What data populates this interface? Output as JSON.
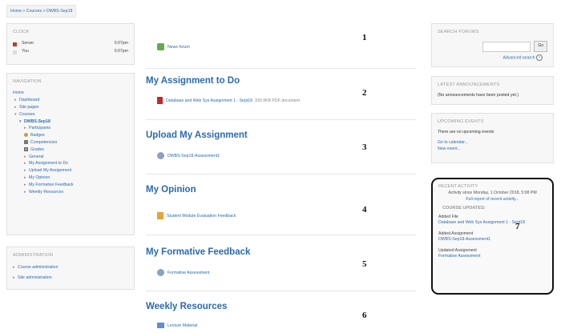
{
  "breadcrumb": {
    "home": "Home",
    "sep1": ">",
    "courses": "Courses",
    "sep2": ">",
    "course": "DWBS-Sep18"
  },
  "clock": {
    "title": "CLOCK",
    "rows": [
      {
        "name": "Server",
        "time": "5:07pm"
      },
      {
        "name": "You",
        "time": "5:07pm"
      }
    ]
  },
  "navigation": {
    "title": "NAVIGATION",
    "items": [
      {
        "label": "Home",
        "caret": ""
      },
      {
        "label": "Dashboard",
        "caret": "▸"
      },
      {
        "label": "Site pages",
        "caret": "▸"
      },
      {
        "label": "Courses",
        "caret": "▾"
      },
      {
        "label": "DWBS-Sep18",
        "caret": "▾"
      },
      {
        "label": "Participants",
        "caret": "▸"
      },
      {
        "label": "Badges",
        "caret": ""
      },
      {
        "label": "Competencies",
        "caret": ""
      },
      {
        "label": "Grades",
        "caret": ""
      },
      {
        "label": "General",
        "caret": "▸"
      },
      {
        "label": "My Assignment to Do",
        "caret": "▸"
      },
      {
        "label": "Upload My Assignment",
        "caret": "▸"
      },
      {
        "label": "My Opinion",
        "caret": "▸"
      },
      {
        "label": "My Formative Feedback",
        "caret": "▸"
      },
      {
        "label": "Weekly Resources",
        "caret": "▸"
      }
    ]
  },
  "administration": {
    "title": "ADMINISTRATION",
    "items": [
      {
        "label": "Course administration",
        "caret": "▸"
      },
      {
        "label": "Site administration",
        "caret": "▸"
      }
    ]
  },
  "sections": [
    {
      "title": "",
      "activity": "News forum",
      "meta": "",
      "number": "1"
    },
    {
      "title": "My Assignment to Do",
      "activity": "Database and Web Sys Assignment 1 - Sept18",
      "meta": "330.9KB PDF document",
      "number": "2"
    },
    {
      "title": "Upload My Assignment",
      "activity": "DWBS-Sep18-Assessment1",
      "meta": "",
      "number": "3"
    },
    {
      "title": "My Opinion",
      "activity": "Student Module Evaluation Feedback",
      "meta": "",
      "number": "4"
    },
    {
      "title": "My Formative Feedback",
      "activity": "Formative Assessment",
      "meta": "",
      "number": "5"
    },
    {
      "title": "Weekly Resources",
      "activity": "Lecture Material",
      "meta": "",
      "number": "6"
    }
  ],
  "search_forums": {
    "title": "SEARCH FORUMS",
    "go": "Go",
    "advanced": "Advanced search",
    "help": "?"
  },
  "latest_announcements": {
    "title": "LATEST ANNOUNCEMENTS",
    "text": "(No announcements have been posted yet.)"
  },
  "upcoming_events": {
    "title": "UPCOMING EVENTS",
    "text": "There are no upcoming events",
    "calendar": "Go to calendar...",
    "new_event": "New event..."
  },
  "recent_activity": {
    "title": "RECENT ACTIVITY",
    "since": "Activity since Monday, 1 October 2018, 5:08 PM",
    "full_report": "Full report of recent activity...",
    "updates_title": "COURSE UPDATES:",
    "number": "7",
    "updates": [
      {
        "label": "Added File",
        "link": "Database and Web Sys Assignment 1 - Sept18"
      },
      {
        "label": "Added Assignment",
        "link": "DWBS-Sep18-Assessment1"
      },
      {
        "label": "Updated Assignment",
        "link": "Formative Assessment"
      }
    ]
  },
  "colors": {
    "link": "#2a6ab0",
    "block_bg": "#f7f7f7",
    "heading": "#2a6ab0",
    "highlight_border": "#111111"
  }
}
